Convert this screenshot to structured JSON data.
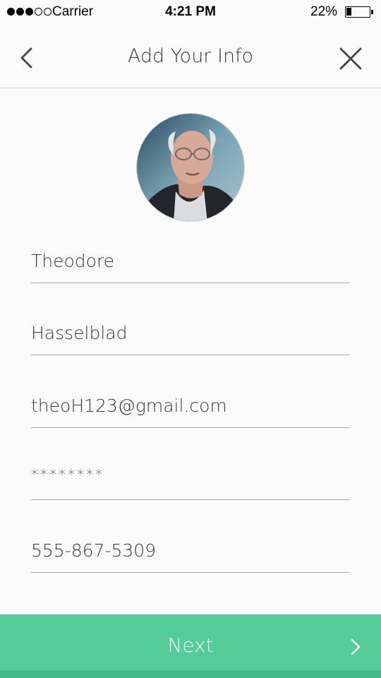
{
  "status_bar": {
    "carrier": "Carrier",
    "time": "4:21 PM",
    "battery_percent": "22%",
    "battery_level": 0.22,
    "signal_bars": 3,
    "signal_total": 5
  },
  "header": {
    "title": "Add Your Info",
    "back_icon": "chevron-left-icon",
    "close_icon": "close-icon"
  },
  "profile": {
    "avatar": "profile-photo"
  },
  "form": {
    "first_name": "Theodore",
    "last_name": "Hasselblad",
    "email": "theoH123@gmail.com",
    "password": "********",
    "phone": "555-867-5309"
  },
  "footer": {
    "next_label": "Next",
    "next_icon": "chevron-right-icon",
    "color": "#53cc97"
  }
}
